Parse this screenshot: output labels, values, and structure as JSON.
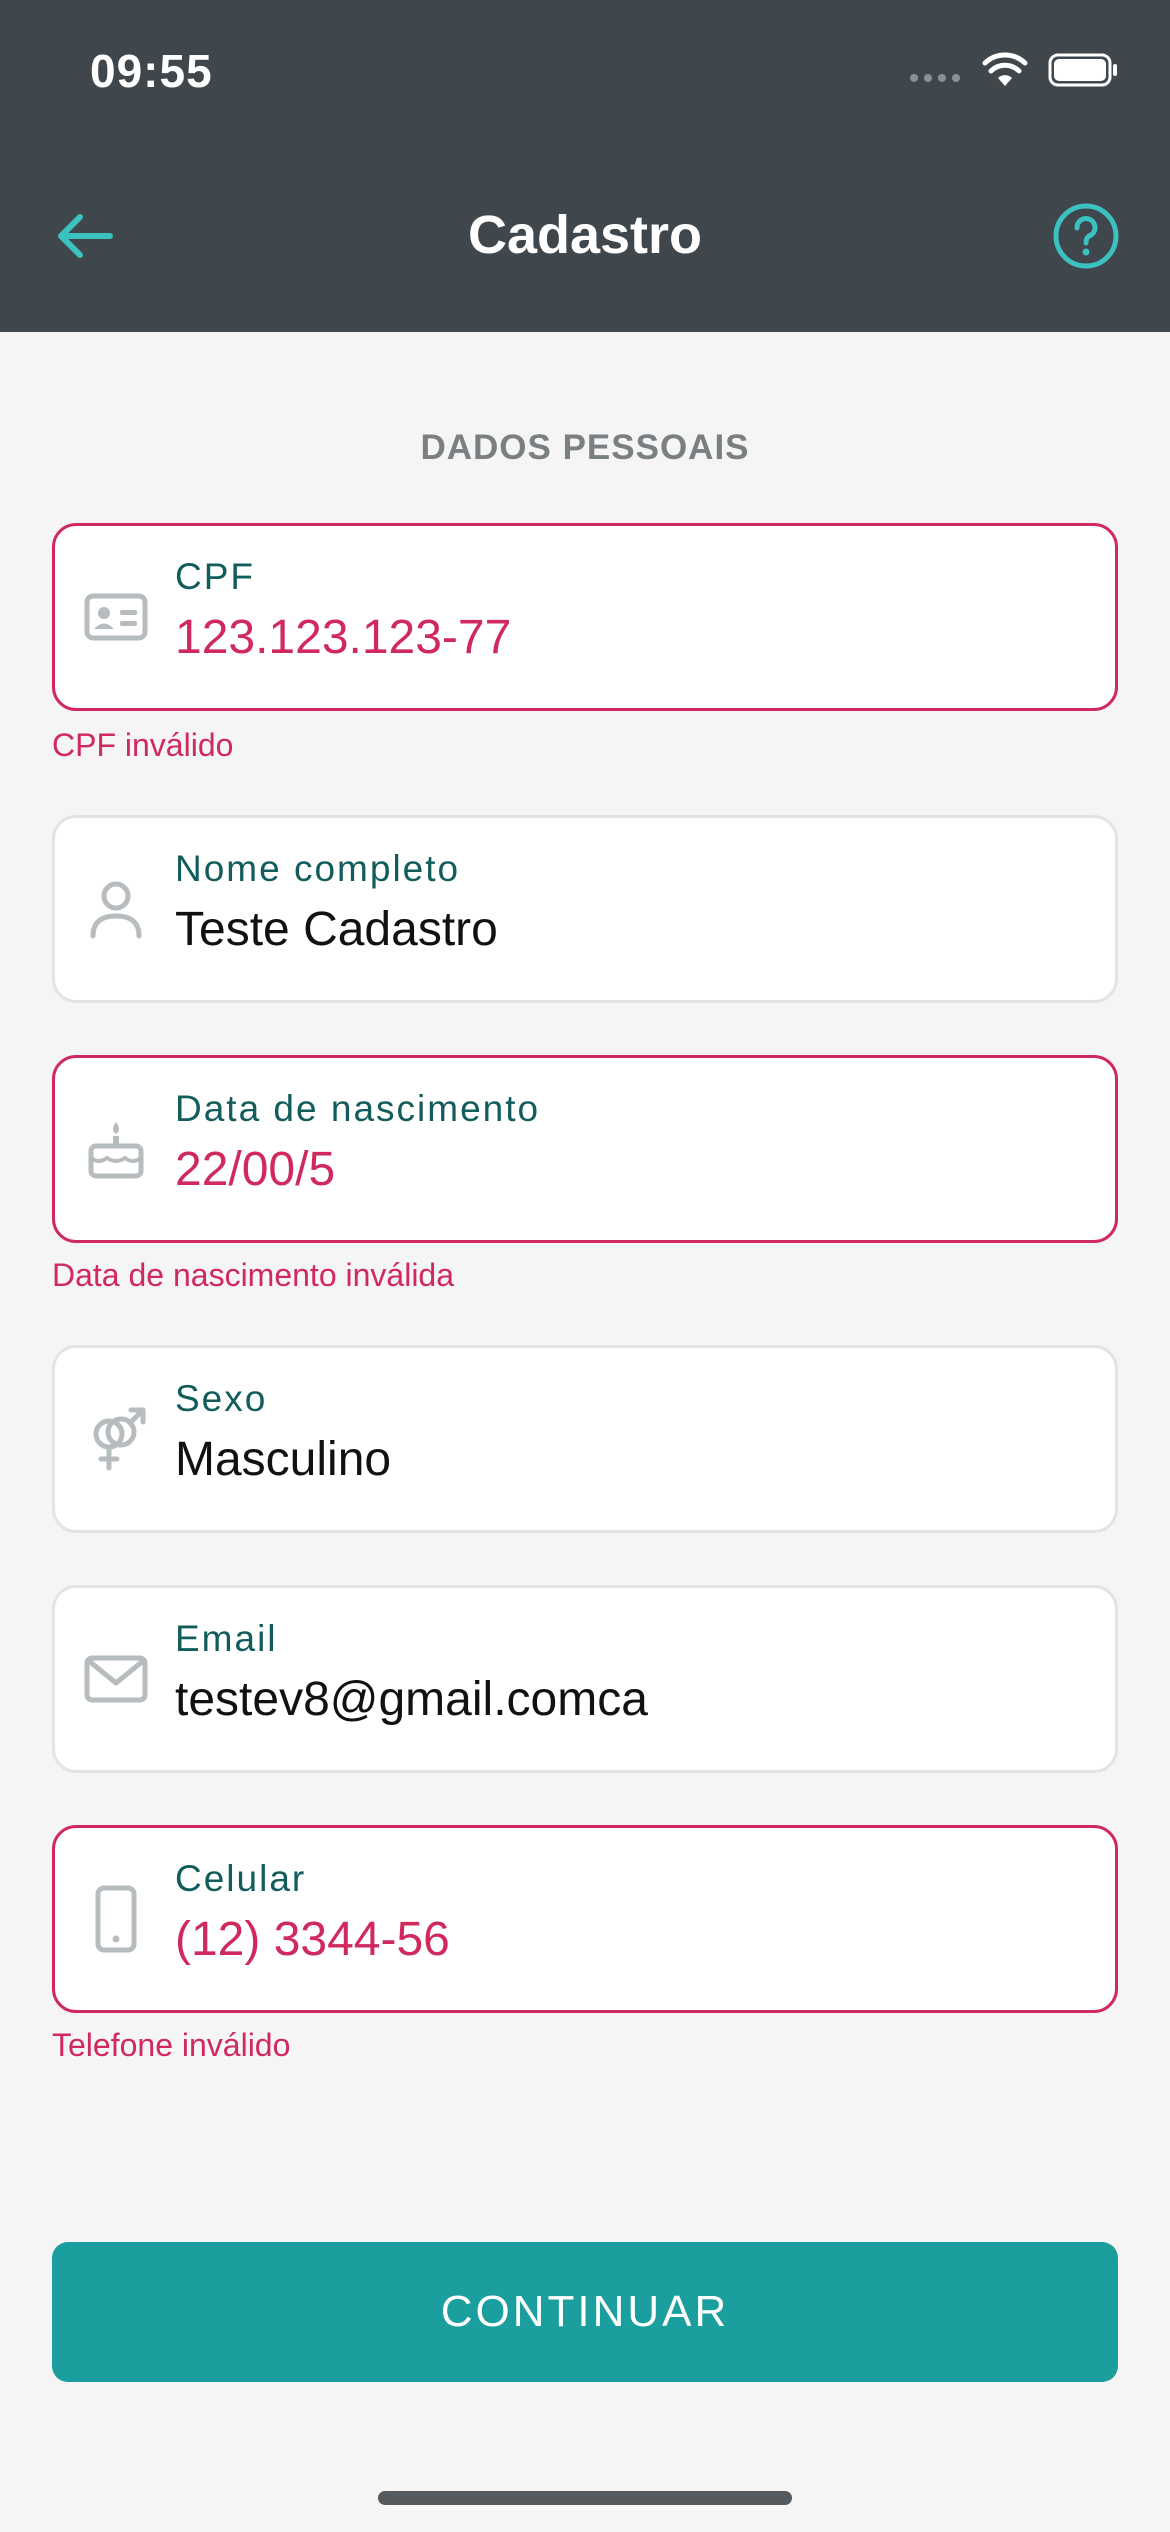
{
  "status_bar": {
    "time": "09:55"
  },
  "header": {
    "title": "Cadastro"
  },
  "section": {
    "title": "DADOS PESSOAIS"
  },
  "fields": [
    {
      "label": "CPF",
      "value": "123.123.123-77",
      "error": "CPF inválido",
      "icon": "id-card-icon"
    },
    {
      "label": "Nome completo",
      "value": "Teste Cadastro",
      "error": null,
      "icon": "user-icon"
    },
    {
      "label": "Data de nascimento",
      "value": "22/00/5",
      "error": "Data de nascimento inválida",
      "icon": "cake-icon"
    },
    {
      "label": "Sexo",
      "value": "Masculino",
      "error": null,
      "icon": "gender-icon"
    },
    {
      "label": "Email",
      "value": "testev8@gmail.comca",
      "error": null,
      "icon": "envelope-icon"
    },
    {
      "label": "Celular",
      "value": "(12) 3344-56",
      "error": "Telefone inválido",
      "icon": "phone-icon"
    }
  ],
  "button": {
    "continue_label": "CONTINUAR"
  },
  "colors": {
    "header_bg": "#40474c",
    "accent": "#1b9e9e",
    "error": "#d0295d",
    "label": "#125c5c"
  }
}
